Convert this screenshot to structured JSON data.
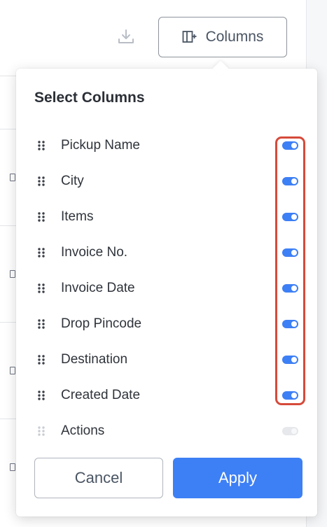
{
  "toolbar": {
    "download_icon": "download-icon",
    "columns_icon": "column-add-icon",
    "columns_label": "Columns"
  },
  "popover": {
    "title": "Select Columns",
    "columns": [
      {
        "label": "Pickup Name",
        "enabled": true
      },
      {
        "label": "City",
        "enabled": true
      },
      {
        "label": "Items",
        "enabled": true
      },
      {
        "label": "Invoice No.",
        "enabled": true
      },
      {
        "label": "Invoice Date",
        "enabled": true
      },
      {
        "label": "Drop Pincode",
        "enabled": true
      },
      {
        "label": "Destination",
        "enabled": true
      },
      {
        "label": "Created Date",
        "enabled": true
      },
      {
        "label": "Actions",
        "enabled": false
      }
    ],
    "cancel_label": "Cancel",
    "apply_label": "Apply"
  },
  "colors": {
    "accent": "#3d7ff5",
    "highlight": "#d64a3a",
    "toggle_off": "#e6e8eb"
  }
}
